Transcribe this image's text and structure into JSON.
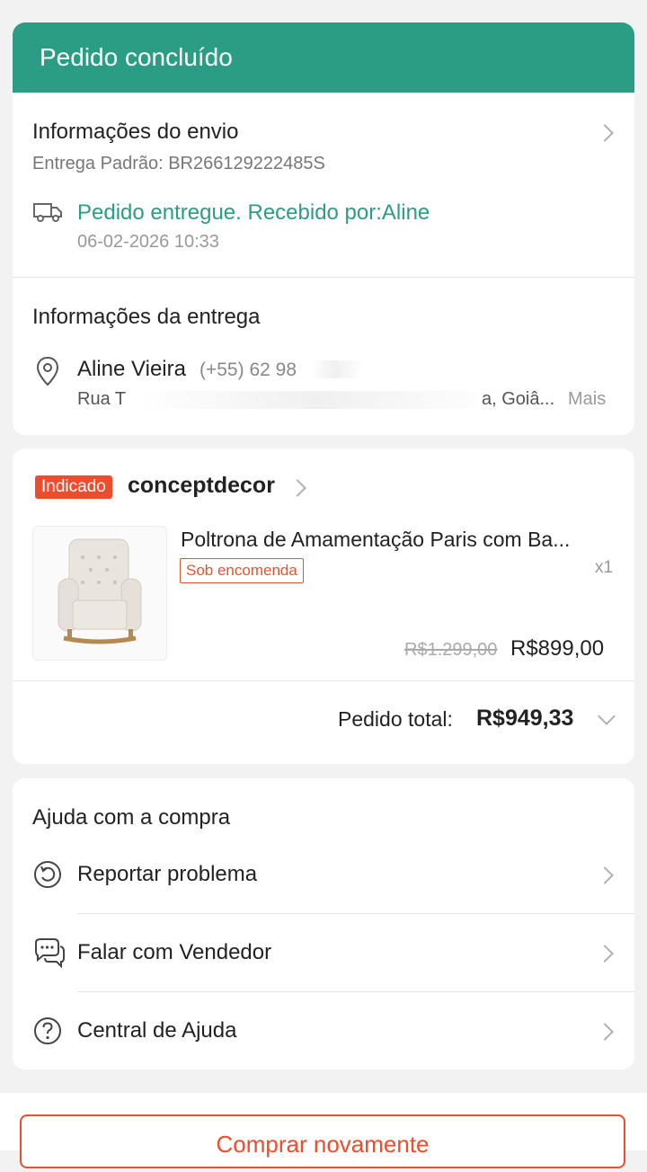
{
  "header": {
    "title": "Pedido concluído"
  },
  "shipping": {
    "title": "Informações do envio",
    "method": "Entrega Padrão: BR266129222485S",
    "status": "Pedido entregue. Recebido por:Aline",
    "timestamp": "06-02-2026 10:33"
  },
  "delivery": {
    "title": "Informações da entrega",
    "name": "Aline Vieira",
    "phone": "(+55) 62 98",
    "address_start": "Rua T",
    "address_end": "a, Goiâ...",
    "more": "Mais"
  },
  "order": {
    "badge": "Indicado",
    "shop": "conceptdecor",
    "product_name": "Poltrona de Amamentação Paris com Ba...",
    "tag": "Sob encomenda",
    "quantity": "x1",
    "old_price": "R$1.299,00",
    "price": "R$899,00",
    "total_label": "Pedido total:",
    "total_value": "R$949,33"
  },
  "help": {
    "title": "Ajuda com a compra",
    "items": [
      {
        "label": "Reportar problema",
        "icon": "report-icon"
      },
      {
        "label": "Falar com Vendedor",
        "icon": "chat-icon"
      },
      {
        "label": "Central de Ajuda",
        "icon": "help-icon"
      }
    ]
  },
  "footer": {
    "buy_again": "Comprar novamente"
  },
  "colors": {
    "accent": "#2a9d84",
    "brand": "#ee4d2d"
  }
}
